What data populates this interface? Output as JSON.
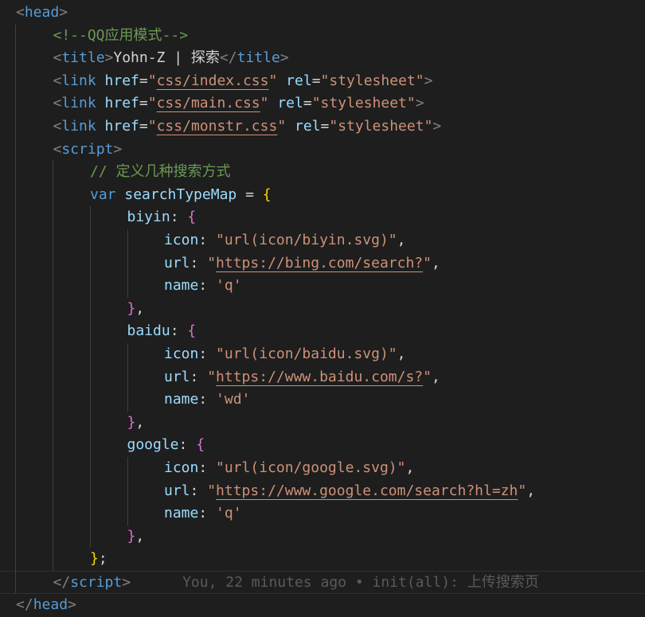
{
  "editor": {
    "lines": [
      {
        "indent": 0,
        "tokens": [
          {
            "t": "tagbr",
            "v": "<"
          },
          {
            "t": "tag",
            "v": "head"
          },
          {
            "t": "tagbr",
            "v": ">"
          }
        ]
      },
      {
        "indent": 1,
        "tokens": [
          {
            "t": "comment",
            "v": "<!--QQ应用模式-->"
          }
        ]
      },
      {
        "indent": 1,
        "tokens": [
          {
            "t": "tagbr",
            "v": "<"
          },
          {
            "t": "tag",
            "v": "title"
          },
          {
            "t": "tagbr",
            "v": ">"
          },
          {
            "t": "plain",
            "v": "Yohn-Z | 探索"
          },
          {
            "t": "tagbr",
            "v": "</"
          },
          {
            "t": "tag",
            "v": "title"
          },
          {
            "t": "tagbr",
            "v": ">"
          }
        ]
      },
      {
        "indent": 1,
        "tokens": [
          {
            "t": "tagbr",
            "v": "<"
          },
          {
            "t": "tag",
            "v": "link"
          },
          {
            "t": "plain",
            "v": " "
          },
          {
            "t": "attr",
            "v": "href"
          },
          {
            "t": "punc",
            "v": "="
          },
          {
            "t": "str",
            "v": "\""
          },
          {
            "t": "url",
            "v": "css/index.css"
          },
          {
            "t": "str",
            "v": "\""
          },
          {
            "t": "plain",
            "v": " "
          },
          {
            "t": "attr",
            "v": "rel"
          },
          {
            "t": "punc",
            "v": "="
          },
          {
            "t": "str",
            "v": "\"stylesheet\""
          },
          {
            "t": "tagbr",
            "v": ">"
          }
        ]
      },
      {
        "indent": 1,
        "tokens": [
          {
            "t": "tagbr",
            "v": "<"
          },
          {
            "t": "tag",
            "v": "link"
          },
          {
            "t": "plain",
            "v": " "
          },
          {
            "t": "attr",
            "v": "href"
          },
          {
            "t": "punc",
            "v": "="
          },
          {
            "t": "str",
            "v": "\""
          },
          {
            "t": "url",
            "v": "css/main.css"
          },
          {
            "t": "str",
            "v": "\""
          },
          {
            "t": "plain",
            "v": " "
          },
          {
            "t": "attr",
            "v": "rel"
          },
          {
            "t": "punc",
            "v": "="
          },
          {
            "t": "str",
            "v": "\"stylesheet\""
          },
          {
            "t": "tagbr",
            "v": ">"
          }
        ]
      },
      {
        "indent": 1,
        "tokens": [
          {
            "t": "tagbr",
            "v": "<"
          },
          {
            "t": "tag",
            "v": "link"
          },
          {
            "t": "plain",
            "v": " "
          },
          {
            "t": "attr",
            "v": "href"
          },
          {
            "t": "punc",
            "v": "="
          },
          {
            "t": "str",
            "v": "\""
          },
          {
            "t": "url",
            "v": "css/monstr.css"
          },
          {
            "t": "str",
            "v": "\""
          },
          {
            "t": "plain",
            "v": " "
          },
          {
            "t": "attr",
            "v": "rel"
          },
          {
            "t": "punc",
            "v": "="
          },
          {
            "t": "str",
            "v": "\"stylesheet\""
          },
          {
            "t": "tagbr",
            "v": ">"
          }
        ]
      },
      {
        "indent": 1,
        "tokens": [
          {
            "t": "tagbr",
            "v": "<"
          },
          {
            "t": "tag",
            "v": "script"
          },
          {
            "t": "tagbr",
            "v": ">"
          }
        ]
      },
      {
        "indent": 2,
        "tokens": [
          {
            "t": "comment",
            "v": "// 定义几种搜索方式"
          }
        ]
      },
      {
        "indent": 2,
        "tokens": [
          {
            "t": "kw",
            "v": "var"
          },
          {
            "t": "plain",
            "v": " "
          },
          {
            "t": "var",
            "v": "searchTypeMap"
          },
          {
            "t": "punc",
            "v": " = "
          },
          {
            "t": "b1",
            "v": "{"
          }
        ]
      },
      {
        "indent": 3,
        "tokens": [
          {
            "t": "prop",
            "v": "biyin"
          },
          {
            "t": "punc",
            "v": ": "
          },
          {
            "t": "b2",
            "v": "{"
          }
        ]
      },
      {
        "indent": 4,
        "tokens": [
          {
            "t": "prop",
            "v": "icon"
          },
          {
            "t": "punc",
            "v": ": "
          },
          {
            "t": "str",
            "v": "\"url(icon/biyin.svg)\""
          },
          {
            "t": "punc",
            "v": ","
          }
        ]
      },
      {
        "indent": 4,
        "tokens": [
          {
            "t": "prop",
            "v": "url"
          },
          {
            "t": "punc",
            "v": ": "
          },
          {
            "t": "str",
            "v": "\""
          },
          {
            "t": "url",
            "v": "https://bing.com/search?"
          },
          {
            "t": "str",
            "v": "\""
          },
          {
            "t": "punc",
            "v": ","
          }
        ]
      },
      {
        "indent": 4,
        "tokens": [
          {
            "t": "prop",
            "v": "name"
          },
          {
            "t": "punc",
            "v": ": "
          },
          {
            "t": "str",
            "v": "'q'"
          }
        ]
      },
      {
        "indent": 3,
        "tokens": [
          {
            "t": "b2",
            "v": "}"
          },
          {
            "t": "punc",
            "v": ","
          }
        ]
      },
      {
        "indent": 3,
        "tokens": [
          {
            "t": "prop",
            "v": "baidu"
          },
          {
            "t": "punc",
            "v": ": "
          },
          {
            "t": "b2",
            "v": "{"
          }
        ]
      },
      {
        "indent": 4,
        "tokens": [
          {
            "t": "prop",
            "v": "icon"
          },
          {
            "t": "punc",
            "v": ": "
          },
          {
            "t": "str",
            "v": "\"url(icon/baidu.svg)\""
          },
          {
            "t": "punc",
            "v": ","
          }
        ]
      },
      {
        "indent": 4,
        "tokens": [
          {
            "t": "prop",
            "v": "url"
          },
          {
            "t": "punc",
            "v": ": "
          },
          {
            "t": "str",
            "v": "\""
          },
          {
            "t": "url",
            "v": "https://www.baidu.com/s?"
          },
          {
            "t": "str",
            "v": "\""
          },
          {
            "t": "punc",
            "v": ","
          }
        ]
      },
      {
        "indent": 4,
        "tokens": [
          {
            "t": "prop",
            "v": "name"
          },
          {
            "t": "punc",
            "v": ": "
          },
          {
            "t": "str",
            "v": "'wd'"
          }
        ]
      },
      {
        "indent": 3,
        "tokens": [
          {
            "t": "b2",
            "v": "}"
          },
          {
            "t": "punc",
            "v": ","
          }
        ]
      },
      {
        "indent": 3,
        "tokens": [
          {
            "t": "prop",
            "v": "google"
          },
          {
            "t": "punc",
            "v": ": "
          },
          {
            "t": "b2",
            "v": "{"
          }
        ]
      },
      {
        "indent": 4,
        "tokens": [
          {
            "t": "prop",
            "v": "icon"
          },
          {
            "t": "punc",
            "v": ": "
          },
          {
            "t": "str",
            "v": "\"url(icon/google.svg)\""
          },
          {
            "t": "punc",
            "v": ","
          }
        ]
      },
      {
        "indent": 4,
        "tokens": [
          {
            "t": "prop",
            "v": "url"
          },
          {
            "t": "punc",
            "v": ": "
          },
          {
            "t": "str",
            "v": "\""
          },
          {
            "t": "url",
            "v": "https://www.google.com/search?hl=zh"
          },
          {
            "t": "str",
            "v": "\""
          },
          {
            "t": "punc",
            "v": ","
          }
        ]
      },
      {
        "indent": 4,
        "tokens": [
          {
            "t": "prop",
            "v": "name"
          },
          {
            "t": "punc",
            "v": ": "
          },
          {
            "t": "str",
            "v": "'q'"
          }
        ]
      },
      {
        "indent": 3,
        "tokens": [
          {
            "t": "b2",
            "v": "}"
          },
          {
            "t": "punc",
            "v": ","
          }
        ]
      },
      {
        "indent": 2,
        "tokens": [
          {
            "t": "b1",
            "v": "}"
          },
          {
            "t": "punc",
            "v": ";"
          }
        ]
      },
      {
        "indent": 1,
        "current": true,
        "tokens": [
          {
            "t": "tagbr",
            "v": "</"
          },
          {
            "t": "tag",
            "v": "script"
          },
          {
            "t": "tagbr",
            "v": ">"
          },
          {
            "t": "plain",
            "v": "      "
          },
          {
            "t": "blame",
            "v": "You, 22 minutes ago • init(all): 上传搜索页"
          }
        ]
      },
      {
        "indent": 0,
        "tokens": [
          {
            "t": "tagbr",
            "v": "</"
          },
          {
            "t": "tag",
            "v": "head"
          },
          {
            "t": "tagbr",
            "v": ">"
          }
        ]
      }
    ]
  }
}
